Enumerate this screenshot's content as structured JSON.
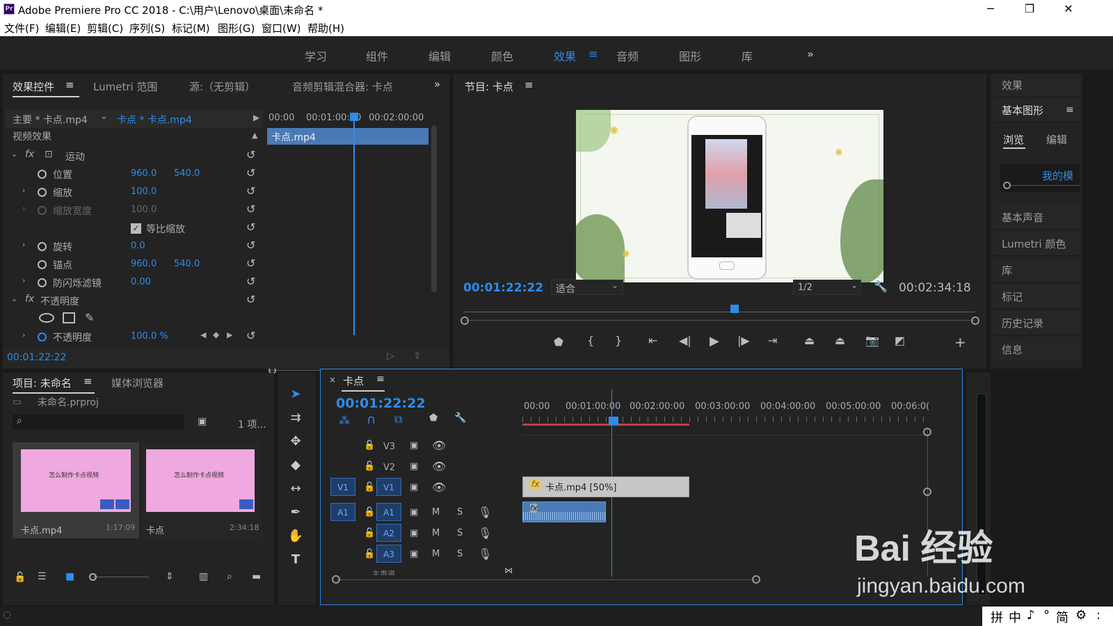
{
  "window": {
    "title": "Adobe Premiere Pro CC 2018 - C:\\用户\\Lenovo\\桌面\\未命名 *",
    "app_icon": "Pr"
  },
  "menu": [
    "文件(F)",
    "编辑(E)",
    "剪辑(C)",
    "序列(S)",
    "标记(M)",
    "图形(G)",
    "窗口(W)",
    "帮助(H)"
  ],
  "workspaces": [
    "学习",
    "组件",
    "编辑",
    "颜色",
    "效果",
    "音频",
    "图形",
    "库"
  ],
  "active_workspace": "效果",
  "effect_controls": {
    "tabs": [
      "效果控件",
      "Lumetri 范围",
      "源:（无剪辑）",
      "音频剪辑混合器: 卡点"
    ],
    "master": "主要 * 卡点.mp4",
    "clip": "卡点 * 卡点.mp4",
    "ruler": [
      "00:00",
      "00:01:00:00",
      "00:02:00:00"
    ],
    "clip_bar": "卡点.mp4",
    "section": "视频效果",
    "motion": "运动",
    "position_label": "位置",
    "position_x": "960.0",
    "position_y": "540.0",
    "scale_label": "缩放",
    "scale": "100.0",
    "scale_width_label": "缩放宽度",
    "scale_width": "100.0",
    "uniform_scale": "等比缩放",
    "rotation_label": "旋转",
    "rotation": "0.0",
    "anchor_label": "锚点",
    "anchor_x": "960.0",
    "anchor_y": "540.0",
    "flicker_label": "防闪烁滤镜",
    "flicker": "0.00",
    "opacity_section": "不透明度",
    "opacity_label": "不透明度",
    "opacity": "100.0 %",
    "timecode": "00:01:22:22"
  },
  "program": {
    "title": "节目: 卡点",
    "timecode": "00:01:22:22",
    "fit": "适合",
    "resolution": "1/2",
    "duration": "00:02:34:18",
    "playhead_fraction": 0.53
  },
  "right_panel": {
    "effects": "效果",
    "essential_graphics": "基本图形",
    "browse": "浏览",
    "edit": "编辑",
    "my_templates": "我的模",
    "items": [
      "基本声音",
      "Lumetri 颜色",
      "库",
      "标记",
      "历史记录",
      "信息"
    ]
  },
  "project": {
    "tabs": [
      "项目: 未命名",
      "媒体浏览器"
    ],
    "file": "未命名.prproj",
    "count": "1 项...",
    "items": [
      {
        "name": "卡点.mp4",
        "duration": "1:17:09",
        "thumb_title": "怎么制作卡点视频"
      },
      {
        "name": "卡点",
        "duration": "2:34:18",
        "thumb_title": "怎么制作卡点视频"
      }
    ]
  },
  "timeline": {
    "title": "卡点",
    "timecode": "00:01:22:22",
    "ruler": [
      "00:00",
      "00:01:00:00",
      "00:02:00:00",
      "00:03:00:00",
      "00:04:00:00",
      "00:05:00:00",
      "00:06:0("
    ],
    "video_tracks": [
      "V3",
      "V2",
      "V1"
    ],
    "audio_tracks": [
      "A1",
      "A2",
      "A3"
    ],
    "source_v": "V1",
    "source_a": "A1",
    "clip": "卡点.mp4 [50%]",
    "mute": "M",
    "solo": "S",
    "master_track": "主声道"
  },
  "ime": {
    "items": [
      "拼",
      "中",
      "♪",
      "°",
      "简",
      "⚙",
      ":"
    ]
  },
  "watermark": {
    "line1": "Bai 经验",
    "line2": "jingyan.baidu.com"
  },
  "colors": {
    "accent": "#2d8ceb",
    "panel": "#232323",
    "bg": "#1a1a1a",
    "clip_video": "#c6c6c6",
    "clip_audio": "#4a7ab5",
    "in_out_bar": "#d23a3a"
  }
}
